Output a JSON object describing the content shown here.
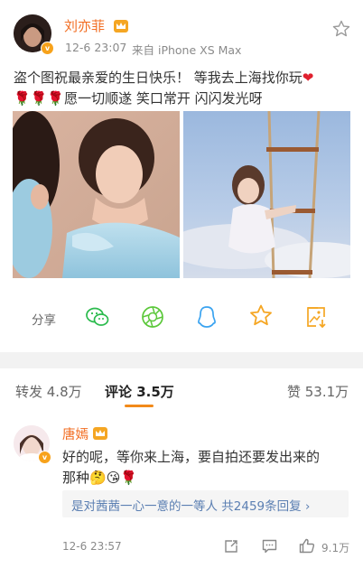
{
  "post": {
    "author": "刘亦菲",
    "time": "12-6 23:07",
    "source": "来自 iPhone XS Max",
    "text_line1": "盗个图祝最亲爱的生日快乐！ 等我去上海找你玩",
    "text_line2": "愿一切顺遂 笑口常开 闪闪发光呀",
    "share_label": "分享"
  },
  "tabs": {
    "repost": "转发 4.8万",
    "comment": "评论 3.5万",
    "like": "赞 53.1万"
  },
  "comment": {
    "author": "唐嫣",
    "text_line1": "好的呢，等你来上海，要自拍还要发出来的",
    "text_line2": "那种",
    "reply_text": "是对茜茜一心一意的一等人 共2459条回复 ›",
    "time": "12-6 23:57",
    "likes": "9.1万"
  },
  "colors": {
    "name": "#f26d22",
    "accent": "#f28a1a",
    "link": "#5b7fb2"
  }
}
